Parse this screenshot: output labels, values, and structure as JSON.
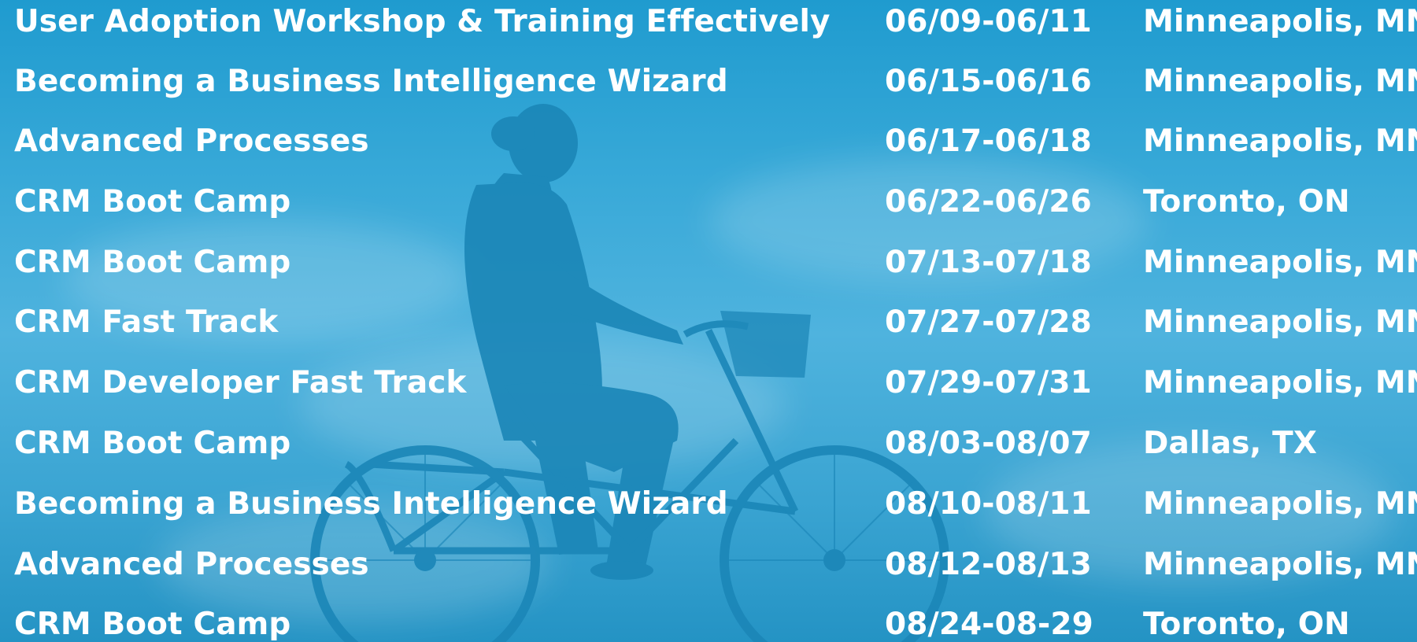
{
  "colors": {
    "text": "#ffffff",
    "sky_top": "#1f9bcf",
    "sky_mid": "#4fb3de",
    "silhouette": "#1c86b8"
  },
  "background_image": "cyclist-silhouette",
  "events": [
    {
      "title": "User Adoption Workshop & Training Effectively",
      "dates": "06/09-06/11",
      "location": "Minneapolis, MN"
    },
    {
      "title": "Becoming a Business Intelligence Wizard",
      "dates": "06/15-06/16",
      "location": "Minneapolis, MN"
    },
    {
      "title": "Advanced Processes",
      "dates": "06/17-06/18",
      "location": "Minneapolis, MN"
    },
    {
      "title": "CRM Boot Camp",
      "dates": "06/22-06/26",
      "location": "Toronto, ON"
    },
    {
      "title": "CRM Boot Camp",
      "dates": "07/13-07/18",
      "location": "Minneapolis, MN"
    },
    {
      "title": "CRM Fast Track",
      "dates": "07/27-07/28",
      "location": "Minneapolis, MN"
    },
    {
      "title": "CRM Developer Fast Track",
      "dates": "07/29-07/31",
      "location": "Minneapolis, MN"
    },
    {
      "title": "CRM Boot Camp",
      "dates": "08/03-08/07",
      "location": "Dallas, TX"
    },
    {
      "title": "Becoming a Business Intelligence Wizard",
      "dates": "08/10-08/11",
      "location": "Minneapolis, MN"
    },
    {
      "title": "Advanced Processes",
      "dates": "08/12-08/13",
      "location": "Minneapolis, MN"
    },
    {
      "title": "CRM Boot Camp",
      "dates": "08/24-08-29",
      "location": "Toronto, ON"
    }
  ]
}
